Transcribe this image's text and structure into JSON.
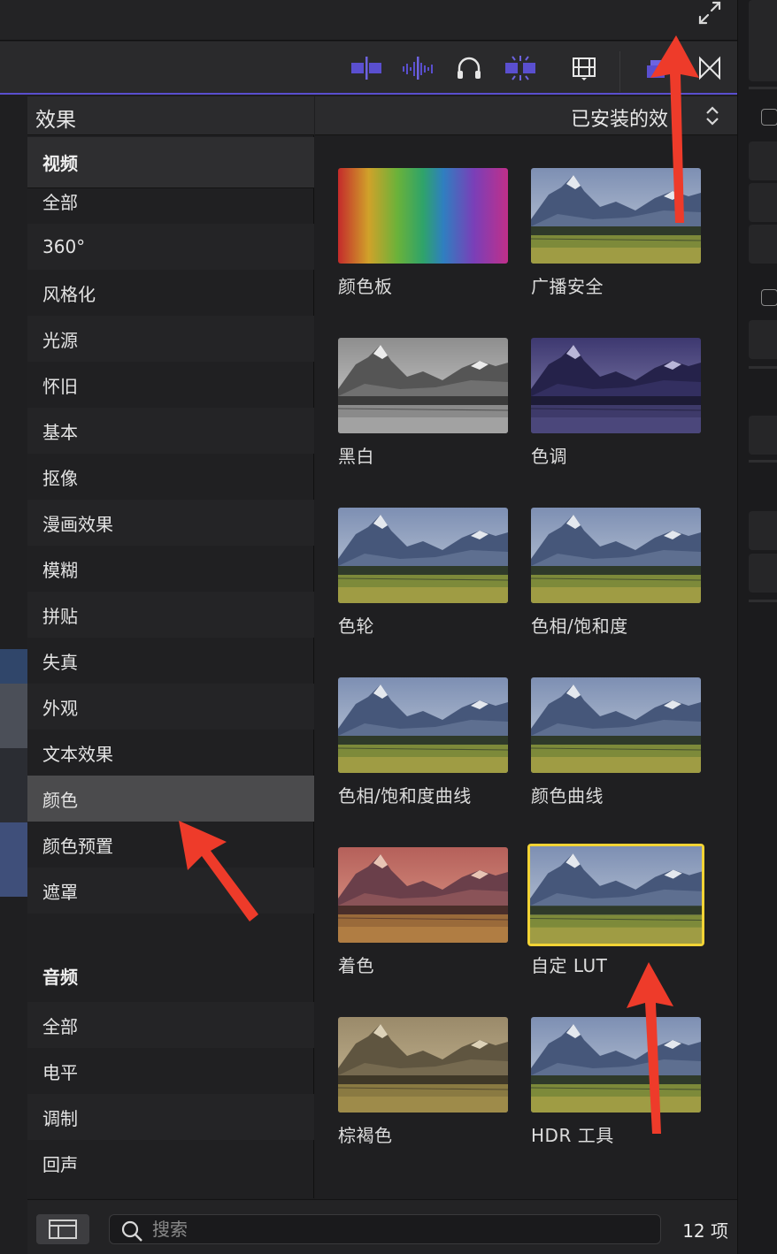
{
  "sidebar": {
    "title": "效果",
    "video_heading": "视频",
    "video_categories": [
      "全部",
      "360°",
      "风格化",
      "光源",
      "怀旧",
      "基本",
      "抠像",
      "漫画效果",
      "模糊",
      "拼贴",
      "失真",
      "外观",
      "文本效果",
      "颜色",
      "颜色预置",
      "遮罩"
    ],
    "selected_category": "颜色",
    "audio_heading": "音频",
    "audio_categories": [
      "全部",
      "电平",
      "调制",
      "回声"
    ]
  },
  "browser": {
    "installed_label": "已安装的效",
    "effects": [
      {
        "label": "颜色板",
        "style": "rainbow"
      },
      {
        "label": "广播安全",
        "style": "natural"
      },
      {
        "label": "黑白",
        "style": "bw"
      },
      {
        "label": "色调",
        "style": "tint-purple"
      },
      {
        "label": "色轮",
        "style": "natural"
      },
      {
        "label": "色相/饱和度",
        "style": "natural"
      },
      {
        "label": "色相/饱和度曲线",
        "style": "natural"
      },
      {
        "label": "颜色曲线",
        "style": "natural"
      },
      {
        "label": "着色",
        "style": "colorize"
      },
      {
        "label": "自定 LUT",
        "style": "natural",
        "selected": true
      },
      {
        "label": "棕褐色",
        "style": "sepia"
      },
      {
        "label": "HDR 工具",
        "style": "natural"
      }
    ]
  },
  "bottom": {
    "search_placeholder": "搜索",
    "item_count": "12 项"
  },
  "colors": {
    "accent_purple": "#5a4fcf",
    "selection_yellow": "#f2d335",
    "annotation_red": "#ee3b2a"
  },
  "icons": {
    "fullscreen": "expand-arrows-icon",
    "toolbar": [
      "clip-skimming-icon",
      "audio-skimming-icon",
      "headphones-icon",
      "snapping-icon",
      "filmstrip-icon",
      "effects-browser-icon",
      "transitions-icon"
    ],
    "sort": "up-down-chevron-icon",
    "search": "magnifier-icon",
    "layout": "sidebar-layout-icon"
  }
}
